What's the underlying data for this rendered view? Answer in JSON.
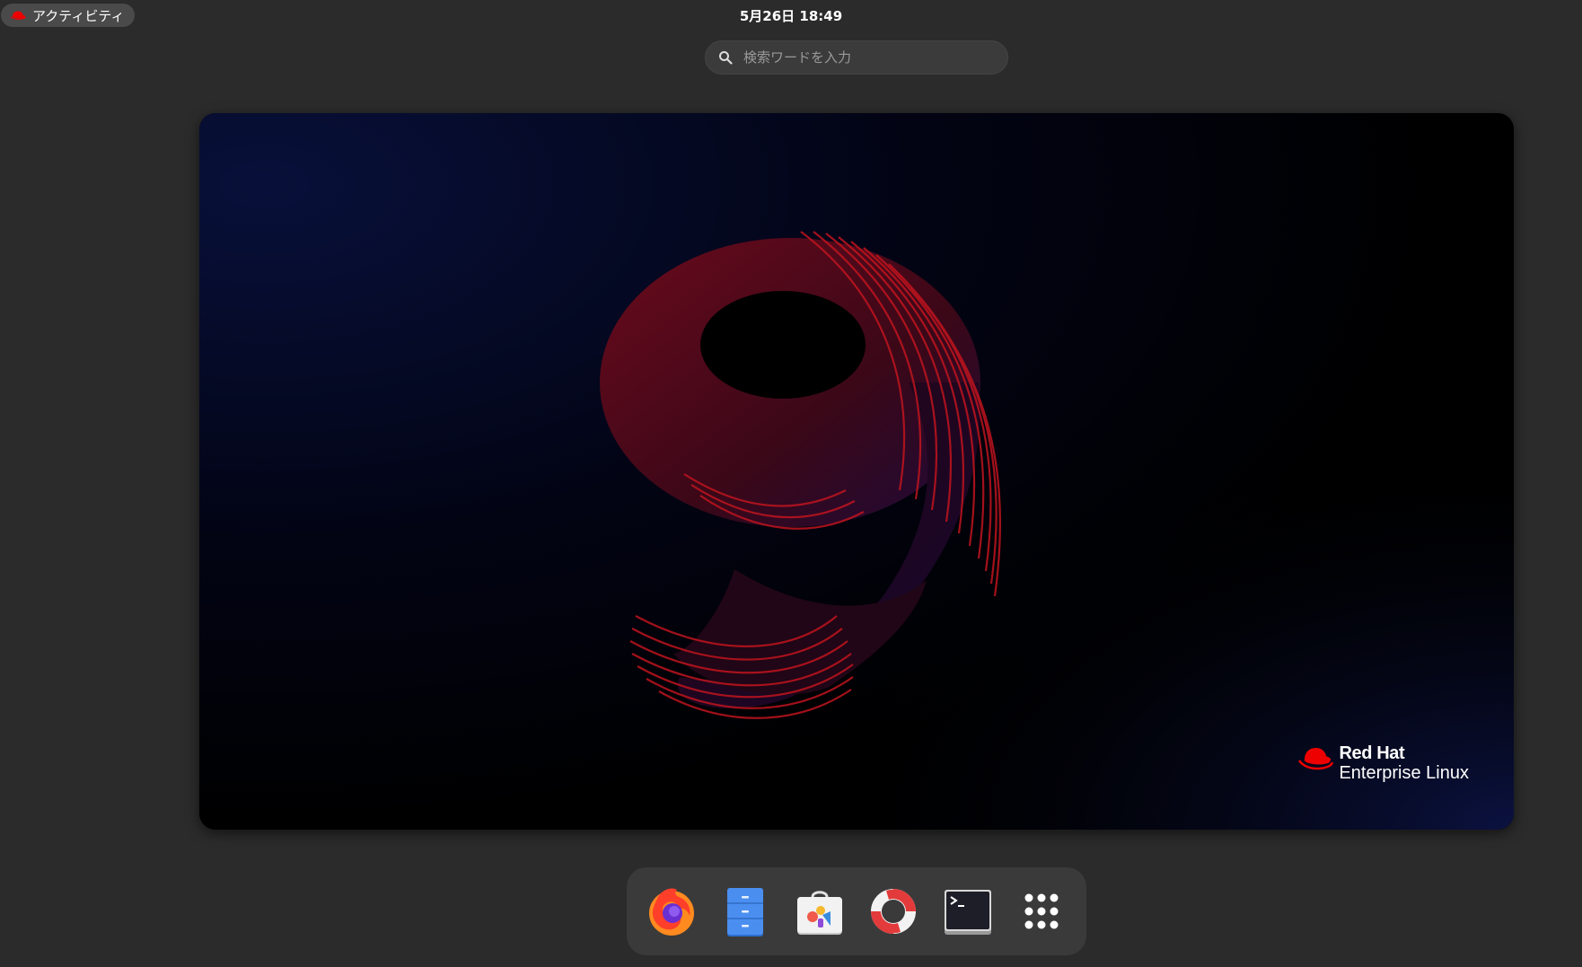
{
  "topbar": {
    "activities_label": "アクティビティ",
    "clock": "5月26日 18:49"
  },
  "search": {
    "placeholder": "検索ワードを入力",
    "value": ""
  },
  "wallpaper": {
    "brand_line1": "Red Hat",
    "brand_line2": "Enterprise Linux",
    "accent_color": "#ee0000"
  },
  "dash": {
    "items": [
      {
        "name": "Firefox",
        "icon": "firefox-icon"
      },
      {
        "name": "Files",
        "icon": "files-icon"
      },
      {
        "name": "Software",
        "icon": "software-icon"
      },
      {
        "name": "Help",
        "icon": "help-lifebuoy-icon"
      },
      {
        "name": "Terminal",
        "icon": "terminal-icon"
      },
      {
        "name": "Show Applications",
        "icon": "app-grid-icon"
      }
    ]
  }
}
